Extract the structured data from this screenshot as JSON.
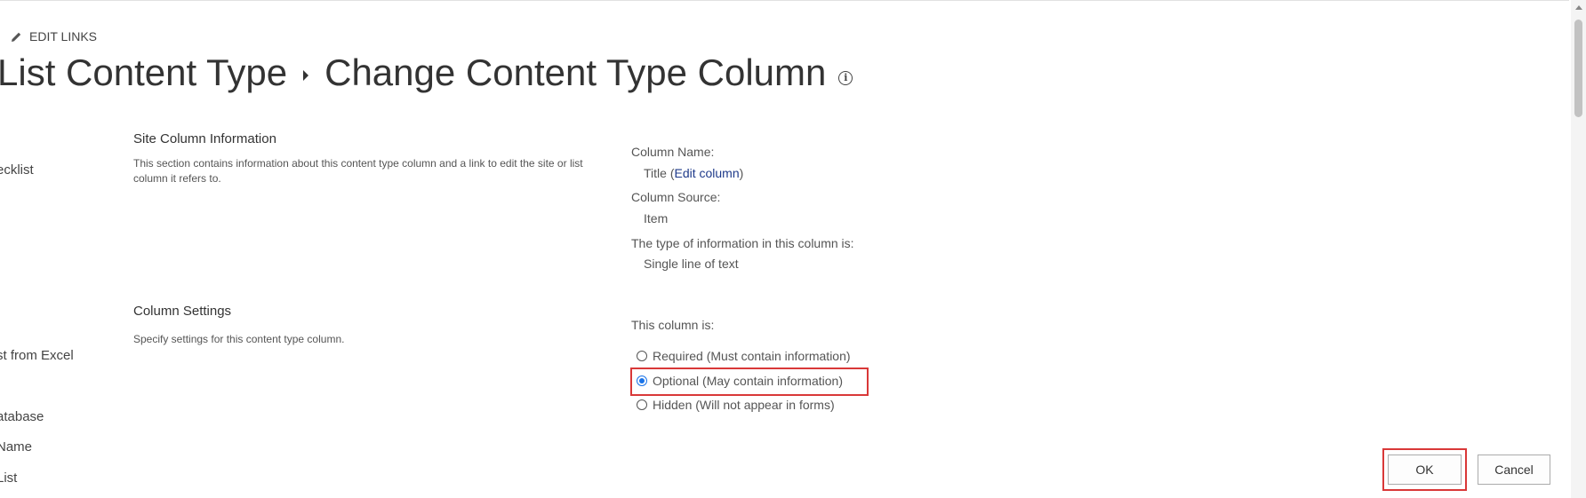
{
  "header": {
    "edit_links": "EDIT LINKS",
    "title_part1": "List Content Type",
    "title_part2": "Change Content Type Column"
  },
  "quick_launch": {
    "items": [
      "ecklist",
      "st from Excel",
      "atabase",
      "Name",
      "List"
    ]
  },
  "site_column_section": {
    "title": "Site Column Information",
    "description": "This section contains information about this content type column and a link to edit the site or list column it refers to.",
    "column_name_label": "Column Name:",
    "column_name_value": "Title (",
    "edit_column_link": "Edit column",
    "column_name_close": ")",
    "column_source_label": "Column Source:",
    "column_source_value": "Item",
    "type_label": "The type of information in this column is:",
    "type_value": "Single line of text"
  },
  "column_settings_section": {
    "title": "Column Settings",
    "description": "Specify settings for this content type column.",
    "prompt": "This column is:",
    "options": [
      {
        "label": "Required (Must contain information)",
        "checked": false
      },
      {
        "label": "Optional (May contain information)",
        "checked": true
      },
      {
        "label": "Hidden (Will not appear in forms)",
        "checked": false
      }
    ]
  },
  "buttons": {
    "ok": "OK",
    "cancel": "Cancel"
  },
  "colors": {
    "accent": "#1a73e8",
    "highlight": "#d93838",
    "link": "#1e3a8a"
  }
}
